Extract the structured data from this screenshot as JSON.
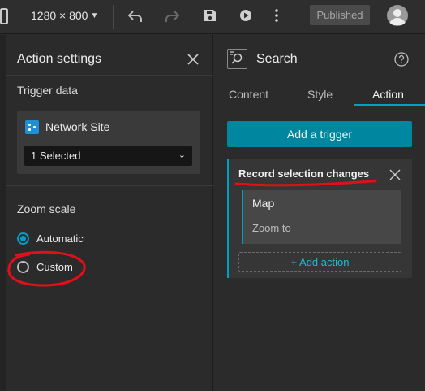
{
  "toolbar": {
    "resolution_label": "1280 × 800",
    "published_label": "Published"
  },
  "action_settings": {
    "title": "Action settings",
    "trigger_data_label": "Trigger data",
    "data_source_name": "Network Site",
    "selection_value": "1 Selected",
    "zoom_scale_label": "Zoom scale",
    "zoom_options": [
      {
        "label": "Automatic",
        "selected": true
      },
      {
        "label": "Custom",
        "selected": false
      }
    ]
  },
  "widget_panel": {
    "title": "Search",
    "tabs": [
      {
        "label": "Content",
        "active": false
      },
      {
        "label": "Style",
        "active": false
      },
      {
        "label": "Action",
        "active": true
      }
    ],
    "add_trigger_label": "Add a trigger",
    "trigger": {
      "title": "Record selection changes",
      "action_target": "Map",
      "action_name": "Zoom to",
      "add_action_label": "+ Add action"
    }
  },
  "colors": {
    "accent": "#00a0c6",
    "button_primary": "#00879f",
    "annotation": "#e0101a"
  }
}
